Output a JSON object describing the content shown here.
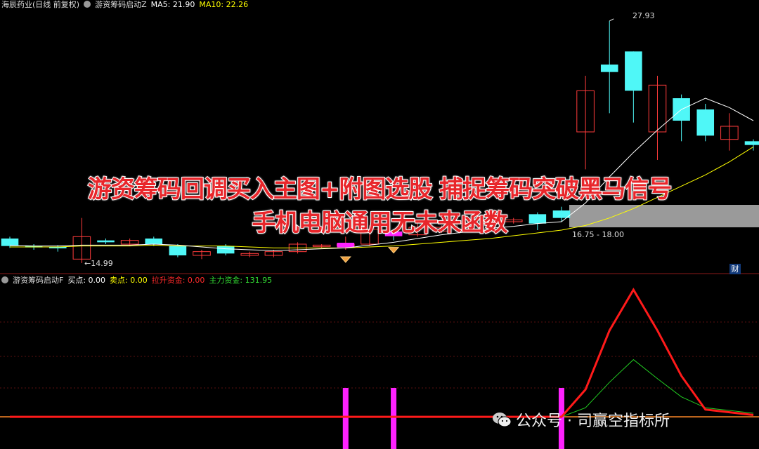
{
  "header": {
    "stock_name": "海辰药业(日线 前复权)",
    "indicator": "游资筹码启动Z",
    "ma5_label": "MA5: 21.90",
    "ma10_label": "MA10: 22.26",
    "colors": {
      "ma5": "#ffffff",
      "ma10": "#ffff00"
    }
  },
  "sub_header": {
    "indicator": "游资筹码启动F",
    "buy_label": "买点: 0.00",
    "sell_label": "卖点: 0.00",
    "lift_label": "拉升资金: 0.00",
    "main_label": "主力资金: 131.95",
    "colors": {
      "buy": "#ffffff",
      "sell": "#ffff00",
      "lift": "#ff2a2a",
      "main": "#33dd33"
    }
  },
  "overlay": {
    "line1": "游资筹码回调买入主图+附图选股 捕捉筹码突破黑马信号",
    "line2": "手机电脑通用无未来函数"
  },
  "labels": {
    "high_price": "27.93",
    "low_price": "←14.99",
    "range": "16.75 - 18.00",
    "cai": "财"
  },
  "watermark": {
    "text": "公众号 · 司赢空指标所",
    "icon": "wechat-icon"
  },
  "chart_data": {
    "type": "candlestick",
    "colors": {
      "up": "#ff3b3b",
      "down": "#4ff7f7",
      "ma5": "#ffffff",
      "ma10": "#ffff00",
      "lift": "#ff1a1a",
      "main": "#22cc22",
      "signal_bar": "#ff22ff"
    },
    "candles": [
      {
        "o": 16.3,
        "c": 15.9,
        "h": 16.4,
        "l": 15.8
      },
      {
        "o": 15.9,
        "c": 15.85,
        "h": 16.0,
        "l": 15.7
      },
      {
        "o": 15.85,
        "c": 15.8,
        "h": 15.95,
        "l": 15.6
      },
      {
        "o": 15.2,
        "c": 16.4,
        "h": 17.4,
        "l": 14.99
      },
      {
        "o": 16.2,
        "c": 16.1,
        "h": 16.3,
        "l": 16.0
      },
      {
        "o": 16.0,
        "c": 16.2,
        "h": 16.3,
        "l": 15.9
      },
      {
        "o": 16.3,
        "c": 16.0,
        "h": 16.4,
        "l": 15.9
      },
      {
        "o": 15.9,
        "c": 15.4,
        "h": 16.0,
        "l": 15.3
      },
      {
        "o": 15.4,
        "c": 15.6,
        "h": 15.7,
        "l": 15.2
      },
      {
        "o": 15.9,
        "c": 15.5,
        "h": 16.0,
        "l": 15.4
      },
      {
        "o": 15.4,
        "c": 15.5,
        "h": 15.6,
        "l": 15.3
      },
      {
        "o": 15.4,
        "c": 15.6,
        "h": 15.7,
        "l": 15.3
      },
      {
        "o": 15.6,
        "c": 16.0,
        "h": 16.1,
        "l": 15.5
      },
      {
        "o": 15.9,
        "c": 15.95,
        "h": 16.0,
        "l": 15.8
      },
      {
        "o": 15.9,
        "c": 16.0,
        "h": 16.4,
        "l": 15.7
      },
      {
        "o": 16.0,
        "c": 16.8,
        "h": 17.0,
        "l": 15.9
      },
      {
        "o": 16.6,
        "c": 16.5,
        "h": 16.7,
        "l": 16.2
      },
      {
        "o": 16.5,
        "c": 16.9,
        "h": 17.1,
        "l": 16.4
      },
      {
        "o": 16.7,
        "c": 16.9,
        "h": 17.0,
        "l": 16.6
      },
      {
        "o": 16.8,
        "c": 17.1,
        "h": 17.2,
        "l": 16.7
      },
      {
        "o": 17.1,
        "c": 17.2,
        "h": 17.3,
        "l": 17.0
      },
      {
        "o": 17.2,
        "c": 17.3,
        "h": 17.4,
        "l": 17.1
      },
      {
        "o": 17.6,
        "c": 17.1,
        "h": 17.7,
        "l": 16.75
      },
      {
        "o": 17.8,
        "c": 17.4,
        "h": 18.0,
        "l": 17.2
      },
      {
        "o": 22.0,
        "c": 24.2,
        "h": 25.0,
        "l": 20.0
      },
      {
        "o": 25.6,
        "c": 25.2,
        "h": 27.93,
        "l": 23.0
      },
      {
        "o": 26.3,
        "c": 24.2,
        "h": 26.3,
        "l": 22.5
      },
      {
        "o": 22.0,
        "c": 24.5,
        "h": 25.0,
        "l": 20.5
      },
      {
        "o": 23.8,
        "c": 22.6,
        "h": 24.0,
        "l": 21.5
      },
      {
        "o": 23.2,
        "c": 21.8,
        "h": 23.5,
        "l": 21.5
      },
      {
        "o": 21.6,
        "c": 22.3,
        "h": 23.0,
        "l": 21.0
      },
      {
        "o": 21.5,
        "c": 21.3,
        "h": 21.6,
        "l": 21.0
      }
    ],
    "ma5": [
      15.95,
      15.9,
      15.9,
      15.95,
      15.95,
      15.95,
      16.0,
      15.95,
      15.85,
      15.75,
      15.7,
      15.65,
      15.7,
      15.75,
      15.8,
      15.95,
      16.1,
      16.3,
      16.5,
      16.65,
      16.85,
      16.95,
      17.1,
      17.2,
      18.2,
      19.6,
      20.9,
      22.1,
      23.2,
      23.8,
      23.3,
      22.6
    ],
    "ma10": [
      15.85,
      15.85,
      15.85,
      15.9,
      15.9,
      15.9,
      15.95,
      15.9,
      15.9,
      15.9,
      15.85,
      15.8,
      15.8,
      15.8,
      15.8,
      15.85,
      15.9,
      16.0,
      16.1,
      16.2,
      16.3,
      16.45,
      16.6,
      16.75,
      17.0,
      17.4,
      17.9,
      18.5,
      19.1,
      19.7,
      20.4,
      21.2
    ],
    "y_range": [
      14.5,
      28.3
    ],
    "buy_signals": [
      14,
      16
    ],
    "sub": {
      "lift": [
        0,
        0,
        0,
        0,
        0,
        0,
        0,
        0,
        0,
        0,
        0,
        0,
        0,
        0,
        0,
        0,
        0,
        0,
        0,
        0,
        0,
        0,
        0,
        0,
        30,
        95,
        140,
        95,
        45,
        8,
        5,
        2
      ],
      "main": [
        0,
        0,
        0,
        0,
        0,
        0,
        0,
        0,
        0,
        0,
        0,
        0,
        0,
        0,
        0,
        0,
        0,
        0,
        0,
        0,
        0,
        0,
        0,
        0,
        10,
        38,
        63,
        42,
        22,
        10,
        7,
        4
      ],
      "signal_bars": [
        14,
        16,
        23
      ],
      "y_range": [
        -3,
        150
      ]
    }
  }
}
